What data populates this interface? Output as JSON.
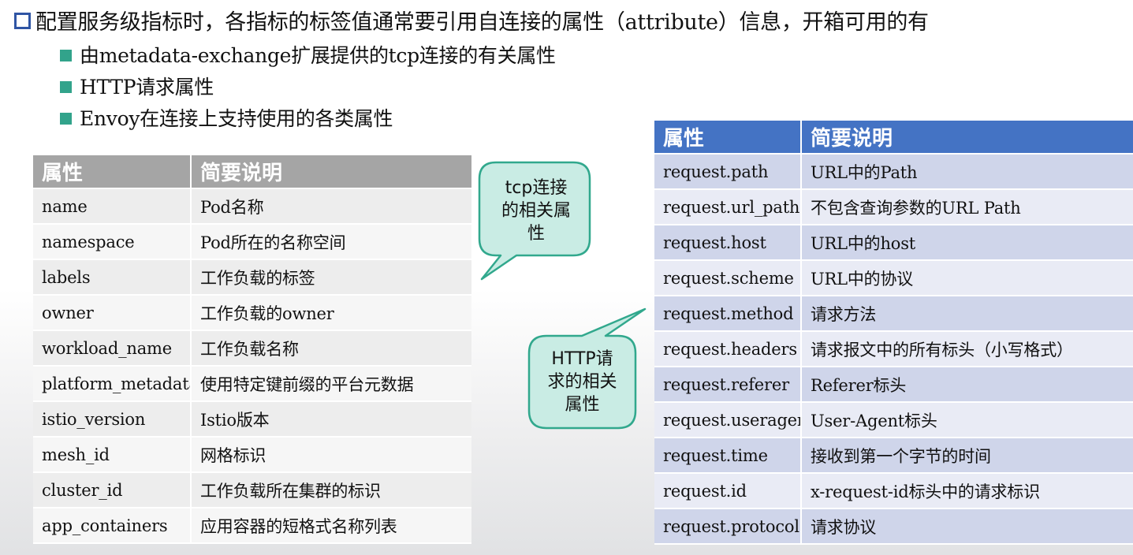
{
  "heading": "配置服务级指标时，各指标的标签值通常要引用自连接的属性（attribute）信息，开箱可用的有",
  "bullets": [
    "由metadata-exchange扩展提供的tcp连接的有关属性",
    "HTTP请求属性",
    "Envoy在连接上支持使用的各类属性"
  ],
  "colors": {
    "heading_box": "#2f55a4",
    "bullet": "#32a38b",
    "left_header": "#a5a5a5",
    "right_header": "#4473c4",
    "callout_fill": "#c9ece4",
    "callout_border": "#31a88d"
  },
  "tcp_table": {
    "headers": [
      "属性",
      "简要说明"
    ],
    "rows": [
      [
        "name",
        "Pod名称"
      ],
      [
        "namespace",
        "Pod所在的名称空间"
      ],
      [
        "labels",
        "工作负载的标签"
      ],
      [
        "owner",
        "工作负载的owner"
      ],
      [
        "workload_name",
        "工作负载名称"
      ],
      [
        "platform_metadata",
        "使用特定键前缀的平台元数据"
      ],
      [
        "istio_version",
        "Istio版本"
      ],
      [
        "mesh_id",
        "网格标识"
      ],
      [
        "cluster_id",
        "工作负载所在集群的标识"
      ],
      [
        "app_containers",
        "应用容器的短格式名称列表"
      ]
    ]
  },
  "http_table": {
    "headers": [
      "属性",
      "简要说明"
    ],
    "rows": [
      [
        "request.path",
        "URL中的Path"
      ],
      [
        "request.url_path",
        "不包含查询参数的URL Path"
      ],
      [
        "request.host",
        "URL中的host"
      ],
      [
        "request.scheme",
        "URL中的协议"
      ],
      [
        "request.method",
        "请求方法"
      ],
      [
        "request.headers",
        "请求报文中的所有标头（小写格式）"
      ],
      [
        "request.referer",
        "Referer标头"
      ],
      [
        "request.useragent",
        "User-Agent标头"
      ],
      [
        "request.time",
        "接收到第一个字节的时间"
      ],
      [
        "request.id",
        "x-request-id标头中的请求标识"
      ],
      [
        "request.protocol",
        "请求协议"
      ]
    ]
  },
  "callouts": {
    "tcp": [
      "tcp连接",
      "的相关属",
      "性"
    ],
    "http": [
      "HTTP请",
      "求的相关",
      "属性"
    ]
  }
}
